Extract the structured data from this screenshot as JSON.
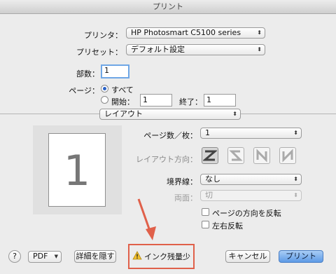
{
  "window": {
    "title": "プリント"
  },
  "printer": {
    "label": "プリンタ：",
    "value": "HP Photosmart C5100 series"
  },
  "preset": {
    "label": "プリセット：",
    "value": "デフォルト設定"
  },
  "copies": {
    "label": "部数：",
    "value": "1"
  },
  "pages": {
    "label": "ページ：",
    "all_label": "すべて",
    "from_label": "開始：",
    "from_value": "1",
    "to_label": "終了：",
    "to_value": "1"
  },
  "section": {
    "value": "レイアウト"
  },
  "preview": {
    "page_number": "1"
  },
  "layout": {
    "pages_per_sheet_label": "ページ数／枚：",
    "pages_per_sheet_value": "1",
    "direction_label": "レイアウト方向：",
    "border_label": "境界線：",
    "border_value": "なし",
    "two_sided_label": "両面：",
    "two_sided_value": "切",
    "reverse_orientation_label": "ページの方向を反転",
    "flip_horizontal_label": "左右反転"
  },
  "footer": {
    "help": "?",
    "pdf_label": "PDF",
    "hide_details_label": "詳細を隠す",
    "ink_warning_label": "インク残量少",
    "cancel_label": "キャンセル",
    "print_label": "プリント"
  },
  "icons": {
    "warning": "warning-icon",
    "arrow": "annotation-arrow"
  },
  "colors": {
    "accent": "#5d9ae6",
    "annotation": "#e0604a",
    "warning": "#f2c12e"
  }
}
